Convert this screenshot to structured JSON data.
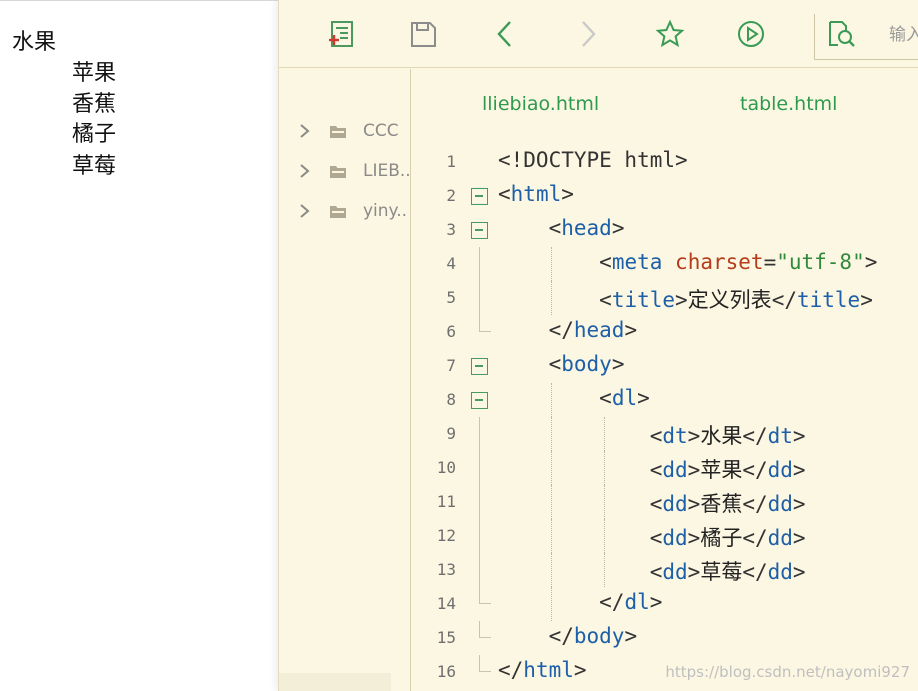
{
  "preview": {
    "term": "水果",
    "items": [
      "苹果",
      "香蕉",
      "橘子",
      "草莓"
    ]
  },
  "toolbar": {
    "buttons": [
      {
        "name": "new-file",
        "icon": "new-file-icon"
      },
      {
        "name": "save",
        "icon": "save-icon"
      },
      {
        "name": "back",
        "icon": "chevron-left-icon"
      },
      {
        "name": "forward",
        "icon": "chevron-right-icon"
      },
      {
        "name": "favorite",
        "icon": "star-icon"
      },
      {
        "name": "run",
        "icon": "play-circle-icon"
      },
      {
        "name": "find",
        "icon": "search-file-icon"
      }
    ],
    "search_placeholder": "输入"
  },
  "filetree": {
    "items": [
      "CCC",
      "LIEB..",
      "yiny.."
    ]
  },
  "tabs": [
    "lliebiao.html",
    "table.html"
  ],
  "code": {
    "line_numbers": [
      "1",
      "2",
      "3",
      "4",
      "5",
      "6",
      "7",
      "8",
      "9",
      "10",
      "11",
      "12",
      "13",
      "14",
      "15",
      "16"
    ],
    "title_text": "定义列表",
    "dt_text": "水果",
    "dd_texts": [
      "苹果",
      "香蕉",
      "橘子",
      "草莓"
    ],
    "charset_value": "\"utf-8\""
  },
  "watermark": "https://blog.csdn.net/nayomi927",
  "colors": {
    "editor_bg": "#fcf7e2",
    "accent_green": "#2e9a4e",
    "tag_blue": "#1d5fa8",
    "attr_red": "#b43c1a",
    "string_green": "#2f8a3c"
  }
}
